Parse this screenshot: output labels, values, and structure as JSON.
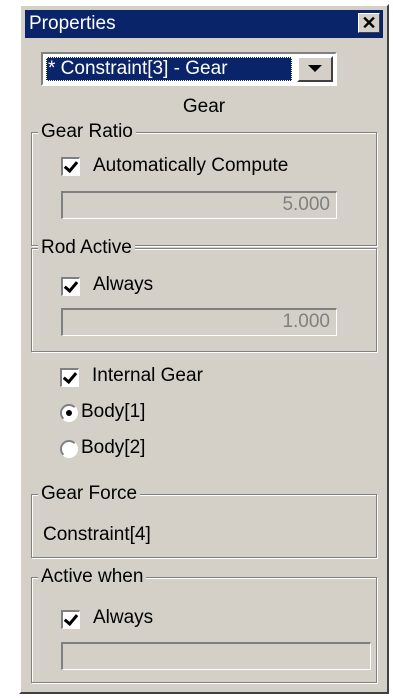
{
  "window": {
    "title": "Properties"
  },
  "selector": {
    "value": "* Constraint[3] - Gear"
  },
  "heading": "Gear",
  "gear_ratio": {
    "title": "Gear Ratio",
    "auto_label": "Automatically Compute",
    "auto_checked": true,
    "value": "5.000"
  },
  "rod_active": {
    "title": "Rod Active",
    "always_label": "Always",
    "always_checked": true,
    "value": "1.000"
  },
  "internal_gear": {
    "label": "Internal Gear",
    "checked": true
  },
  "bodies": [
    {
      "label": "Body[1]",
      "selected": true
    },
    {
      "label": "Body[2]",
      "selected": false
    }
  ],
  "gear_force": {
    "title": "Gear Force",
    "value": "Constraint[4]"
  },
  "active_when": {
    "title": "Active when",
    "always_label": "Always",
    "always_checked": true,
    "value": ""
  }
}
